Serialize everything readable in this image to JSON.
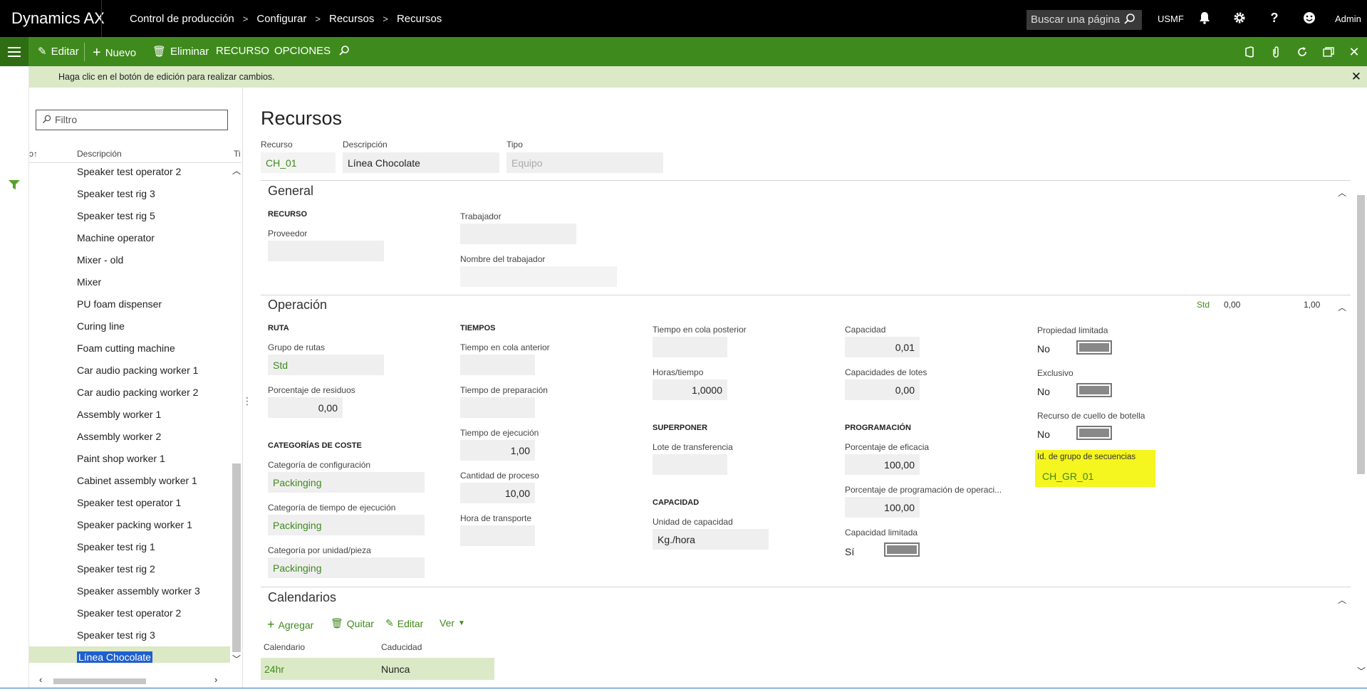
{
  "app": {
    "title": "Dynamics AX"
  },
  "breadcrumb": [
    "Control de producción",
    "Configurar",
    "Recursos",
    "Recursos"
  ],
  "topbar": {
    "search_placeholder": "Buscar una página",
    "company": "USMF",
    "user": "Admin"
  },
  "actionbar": {
    "edit": "Editar",
    "new": "Nuevo",
    "delete": "Eliminar",
    "tab_resource": "RECURSO",
    "tab_options": "OPCIONES"
  },
  "message": "Haga clic en el botón de edición para realizar cambios.",
  "list": {
    "filter_placeholder": "Filtro",
    "col_description": "Descripción",
    "col_type": "Ti",
    "items": [
      "Speaker test operator 2",
      "Speaker test rig 3",
      "Speaker test rig 5",
      "Machine operator",
      "Mixer - old",
      "Mixer",
      "PU foam dispenser",
      "Curing line",
      "Foam cutting machine",
      "Car audio packing worker 1",
      "Car audio packing worker 2",
      "Assembly worker 1",
      "Assembly worker 2",
      "Paint shop worker 1",
      "Cabinet assembly worker 1",
      "Speaker test operator 1",
      "Speaker packing worker 1",
      "Speaker test rig 1",
      "Speaker test rig 2",
      "Speaker assembly worker 3",
      "Speaker test operator 2",
      "Speaker test rig 3",
      "Línea Chocolate"
    ]
  },
  "page": {
    "title": "Recursos"
  },
  "header": {
    "resource_label": "Recurso",
    "resource_value": "CH_01",
    "desc_label": "Descripción",
    "desc_value": "Línea Chocolate",
    "type_label": "Tipo",
    "type_value": "Equipo"
  },
  "general": {
    "title": "General",
    "group_recurso": "RECURSO",
    "vendor_label": "Proveedor",
    "vendor_value": "",
    "worker_label": "Trabajador",
    "worker_value": "",
    "worker_name_label": "Nombre del trabajador",
    "worker_name_value": ""
  },
  "operacion": {
    "title": "Operación",
    "summary": {
      "group": "Std",
      "v1": "0,00",
      "v2": "1,00"
    },
    "ruta": "RUTA",
    "route_group_label": "Grupo de rutas",
    "route_group_value": "Std",
    "scrap_label": "Porcentaje de residuos",
    "scrap_value": "0,00",
    "cost_categories": "CATEGORÍAS DE COSTE",
    "setup_cat_label": "Categoría de configuración",
    "setup_cat_value": "Packinging",
    "run_cat_label": "Categoría de tiempo de ejecución",
    "run_cat_value": "Packinging",
    "unit_cat_label": "Categoría por unidad/pieza",
    "unit_cat_value": "Packinging",
    "tiempos": "TIEMPOS",
    "queue_before_label": "Tiempo en cola anterior",
    "queue_before_value": "",
    "setup_time_label": "Tiempo de preparación",
    "setup_time_value": "",
    "run_time_label": "Tiempo de ejecución",
    "run_time_value": "1,00",
    "process_qty_label": "Cantidad de proceso",
    "process_qty_value": "10,00",
    "transport_label": "Hora de transporte",
    "transport_value": "",
    "queue_after_label": "Tiempo en cola posterior",
    "queue_after_value": "",
    "hours_time_label": "Horas/tiempo",
    "hours_time_value": "1,0000",
    "superponer": "SUPERPONER",
    "transfer_batch_label": "Lote de transferencia",
    "transfer_batch_value": "",
    "capacidad_group": "CAPACIDAD",
    "cap_unit_label": "Unidad de capacidad",
    "cap_unit_value": "Kg./hora",
    "capacity_label": "Capacidad",
    "capacity_value": "0,01",
    "batch_cap_label": "Capacidades de lotes",
    "batch_cap_value": "0,00",
    "programacion": "PROGRAMACIÓN",
    "efficiency_label": "Porcentaje de eficacia",
    "efficiency_value": "100,00",
    "op_sched_label": "Porcentaje de programación de operaci...",
    "op_sched_value": "100,00",
    "finite_cap_label": "Capacidad limitada",
    "finite_cap_value": "Sí",
    "finite_prop_label": "Propiedad limitada",
    "finite_prop_value": "No",
    "exclusive_label": "Exclusivo",
    "exclusive_value": "No",
    "bottleneck_label": "Recurso de cuello de botella",
    "bottleneck_value": "No",
    "seq_group_label": "Id. de grupo de secuencias",
    "seq_group_value": "CH_GR_01"
  },
  "calendarios": {
    "title": "Calendarios",
    "add": "Agregar",
    "remove": "Quitar",
    "edit": "Editar",
    "view": "Ver",
    "col_calendar": "Calendario",
    "col_expiry": "Caducidad",
    "rows": [
      {
        "calendar": "24hr",
        "expiry": "Nunca"
      }
    ]
  },
  "colors": {
    "brand_green": "#3f8a1c",
    "highlight": "#f5f520",
    "topbar": "#000000",
    "selection": "#dbe9c7"
  }
}
